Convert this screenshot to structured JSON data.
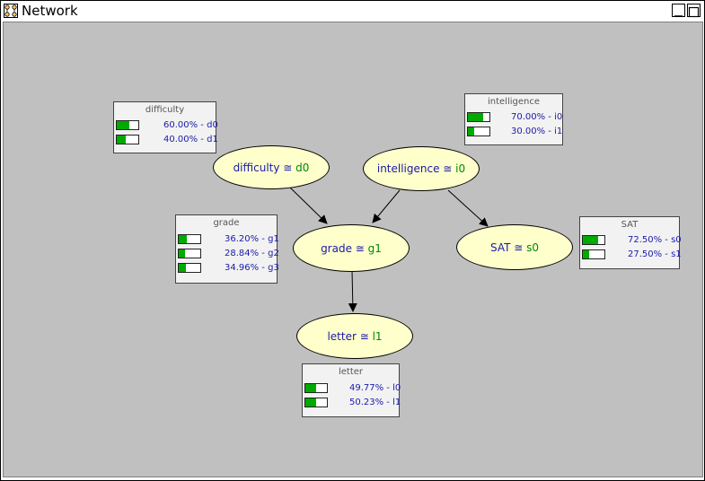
{
  "window": {
    "title": "Network"
  },
  "nodes": {
    "difficulty": {
      "name": "difficulty",
      "sep": " ≅ ",
      "state": "d0"
    },
    "intelligence": {
      "name": "intelligence",
      "sep": " ≅ ",
      "state": "i0"
    },
    "grade": {
      "name": "grade",
      "sep": " ≅ ",
      "state": "g1"
    },
    "sat": {
      "name": "SAT",
      "sep": " ≅ ",
      "state": "s0"
    },
    "letter": {
      "name": "letter",
      "sep": " ≅ ",
      "state": "l1"
    }
  },
  "tables": {
    "difficulty": {
      "title": "difficulty",
      "rows": [
        {
          "label": "60.00% - d0",
          "fraction": 0.6
        },
        {
          "label": "40.00% - d1",
          "fraction": 0.4
        }
      ]
    },
    "intelligence": {
      "title": "intelligence",
      "rows": [
        {
          "label": "70.00% - i0",
          "fraction": 0.7
        },
        {
          "label": "30.00% - i1",
          "fraction": 0.3
        }
      ]
    },
    "grade": {
      "title": "grade",
      "rows": [
        {
          "label": "36.20% - g1",
          "fraction": 0.362
        },
        {
          "label": "28.84% - g2",
          "fraction": 0.2884
        },
        {
          "label": "34.96% - g3",
          "fraction": 0.3496
        }
      ]
    },
    "sat": {
      "title": "SAT",
      "rows": [
        {
          "label": "72.50% - s0",
          "fraction": 0.725
        },
        {
          "label": "27.50% - s1",
          "fraction": 0.275
        }
      ]
    },
    "letter": {
      "title": "letter",
      "rows": [
        {
          "label": "49.77% - l0",
          "fraction": 0.4977
        },
        {
          "label": "50.23% - l1",
          "fraction": 0.5023
        }
      ]
    }
  },
  "edges": [
    {
      "from": "difficulty",
      "to": "grade"
    },
    {
      "from": "intelligence",
      "to": "grade"
    },
    {
      "from": "intelligence",
      "to": "sat"
    },
    {
      "from": "grade",
      "to": "letter"
    }
  ],
  "colors": {
    "canvas": "#c0c0c0",
    "node_fill": "#ffffcc",
    "node_name": "#1a1aaa",
    "node_state": "#008800",
    "bar_fill": "#00aa00"
  }
}
